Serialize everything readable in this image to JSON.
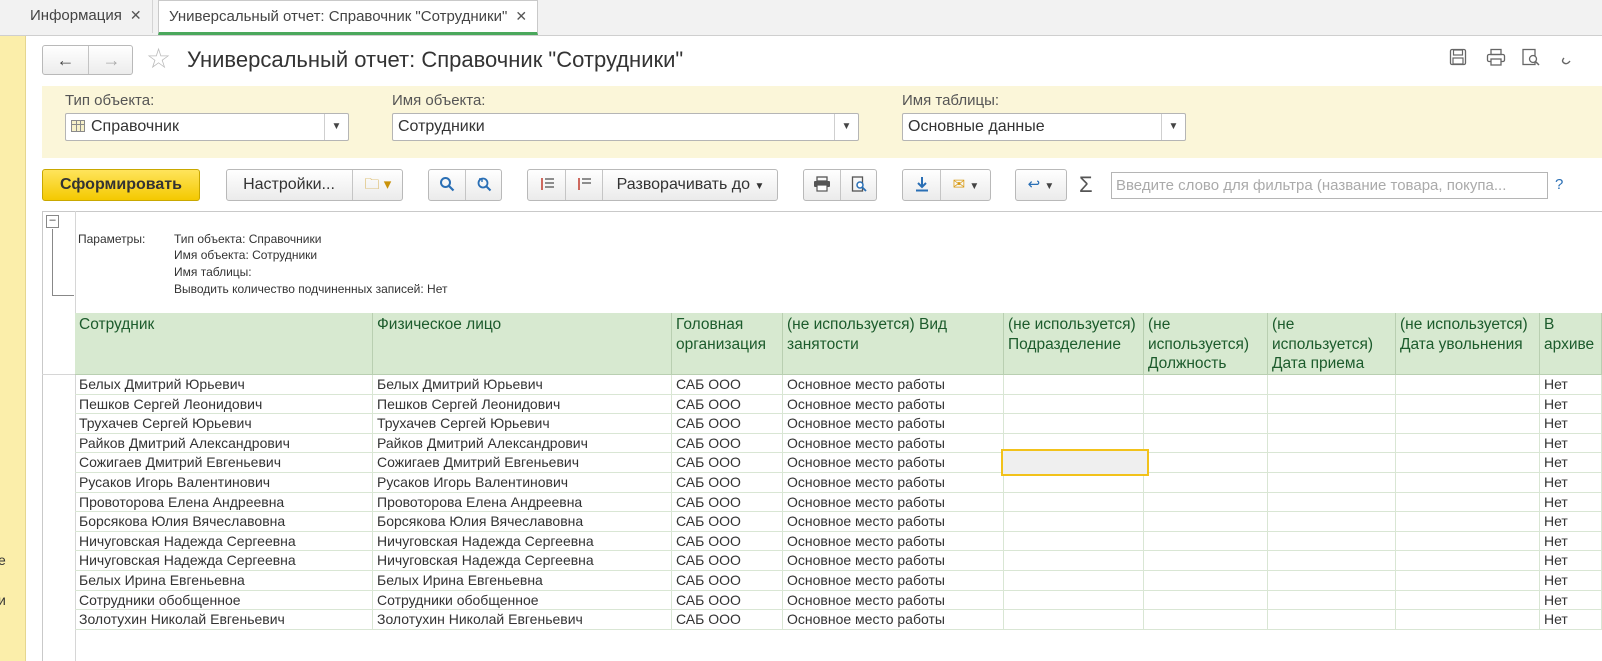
{
  "tabs": [
    {
      "label": "Информация",
      "active": false
    },
    {
      "label": "Универсальный отчет: Справочник \"Сотрудники\"",
      "active": true
    }
  ],
  "left_strip_fragments": [
    "е",
    "и"
  ],
  "header": {
    "title": "Универсальный отчет: Справочник \"Сотрудники\"",
    "icons": [
      "save-icon",
      "print-icon",
      "preview-icon",
      "link-icon"
    ]
  },
  "params": {
    "object_type": {
      "label": "Тип объекта:",
      "value": "Справочник"
    },
    "object_name": {
      "label": "Имя объекта:",
      "value": "Сотрудники"
    },
    "table_name": {
      "label": "Имя таблицы:",
      "value": "Основные данные"
    }
  },
  "toolbar": {
    "generate_label": "Сформировать",
    "settings_label": "Настройки...",
    "expand_label": "Разворачивать до",
    "filter_placeholder": "Введите слово для фильтра (название товара, покупа...",
    "help_label": "?",
    "sigma_label": "Σ"
  },
  "report_params": {
    "label": "Параметры:",
    "lines": [
      "Тип объекта: Справочники",
      "Имя объекта: Сотрудники",
      "Имя таблицы:",
      "Выводить количество подчиненных записей: Нет"
    ]
  },
  "table": {
    "columns": [
      "Сотрудник",
      "Физическое лицо",
      "Головная организация",
      "(не используется) Вид занятости",
      "(не используется) Подразделение",
      "(не используется) Должность",
      "(не используется) Дата приема",
      "(не используется) Дата увольнения",
      "В архиве"
    ],
    "rows": [
      [
        "Белых Дмитрий Юрьевич",
        "Белых Дмитрий Юрьевич",
        "САБ ООО",
        "Основное место работы",
        "",
        "",
        "",
        "",
        "Нет"
      ],
      [
        "Пешков Сергей Леонидович",
        "Пешков Сергей Леонидович",
        "САБ ООО",
        "Основное место работы",
        "",
        "",
        "",
        "",
        "Нет"
      ],
      [
        "Трухачев Сергей Юрьевич",
        "Трухачев Сергей Юрьевич",
        "САБ ООО",
        "Основное место работы",
        "",
        "",
        "",
        "",
        "Нет"
      ],
      [
        "Райков Дмитрий Александрович",
        "Райков Дмитрий Александрович",
        "САБ ООО",
        "Основное место работы",
        "",
        "",
        "",
        "",
        "Нет"
      ],
      [
        "Сожигаев Дмитрий Евгеньевич",
        "Сожигаев Дмитрий Евгеньевич",
        "САБ ООО",
        "Основное место работы",
        "",
        "",
        "",
        "",
        "Нет"
      ],
      [
        "Русаков Игорь Валентинович",
        "Русаков Игорь Валентинович",
        "САБ ООО",
        "Основное место работы",
        "",
        "",
        "",
        "",
        "Нет"
      ],
      [
        "Провоторова Елена Андреевна",
        "Провоторова Елена Андреевна",
        "САБ ООО",
        "Основное место работы",
        "",
        "",
        "",
        "",
        "Нет"
      ],
      [
        "Борсякова Юлия Вячеславовна",
        "Борсякова Юлия Вячеславовна",
        "САБ ООО",
        "Основное место работы",
        "",
        "",
        "",
        "",
        "Нет"
      ],
      [
        "Ничуговская Надежда Сергеевна",
        "Ничуговская Надежда Сергеевна",
        "САБ ООО",
        "Основное место работы",
        "",
        "",
        "",
        "",
        "Нет"
      ],
      [
        "Ничуговская Надежда Сергеевна",
        "Ничуговская Надежда Сергеевна",
        "САБ ООО",
        "Основное место работы",
        "",
        "",
        "",
        "",
        "Нет"
      ],
      [
        "Белых Ирина Евгеньевна",
        "Белых Ирина Евгеньевна",
        "САБ ООО",
        "Основное место работы",
        "",
        "",
        "",
        "",
        "Нет"
      ],
      [
        "Сотрудники обобщенное",
        "Сотрудники обобщенное",
        "САБ ООО",
        "Основное место работы",
        "",
        "",
        "",
        "",
        "Нет"
      ],
      [
        "Золотухин Николай Евгеньевич",
        "Золотухин Николай Евгеньевич",
        "САБ ООО",
        "Основное место работы",
        "",
        "",
        "",
        "",
        "Нет"
      ]
    ]
  },
  "colors": {
    "accent_green": "#4aa85c",
    "header_green": "#d7e9d0",
    "panel_yellow": "#fbf6d9",
    "button_yellow": "#f4c900"
  }
}
